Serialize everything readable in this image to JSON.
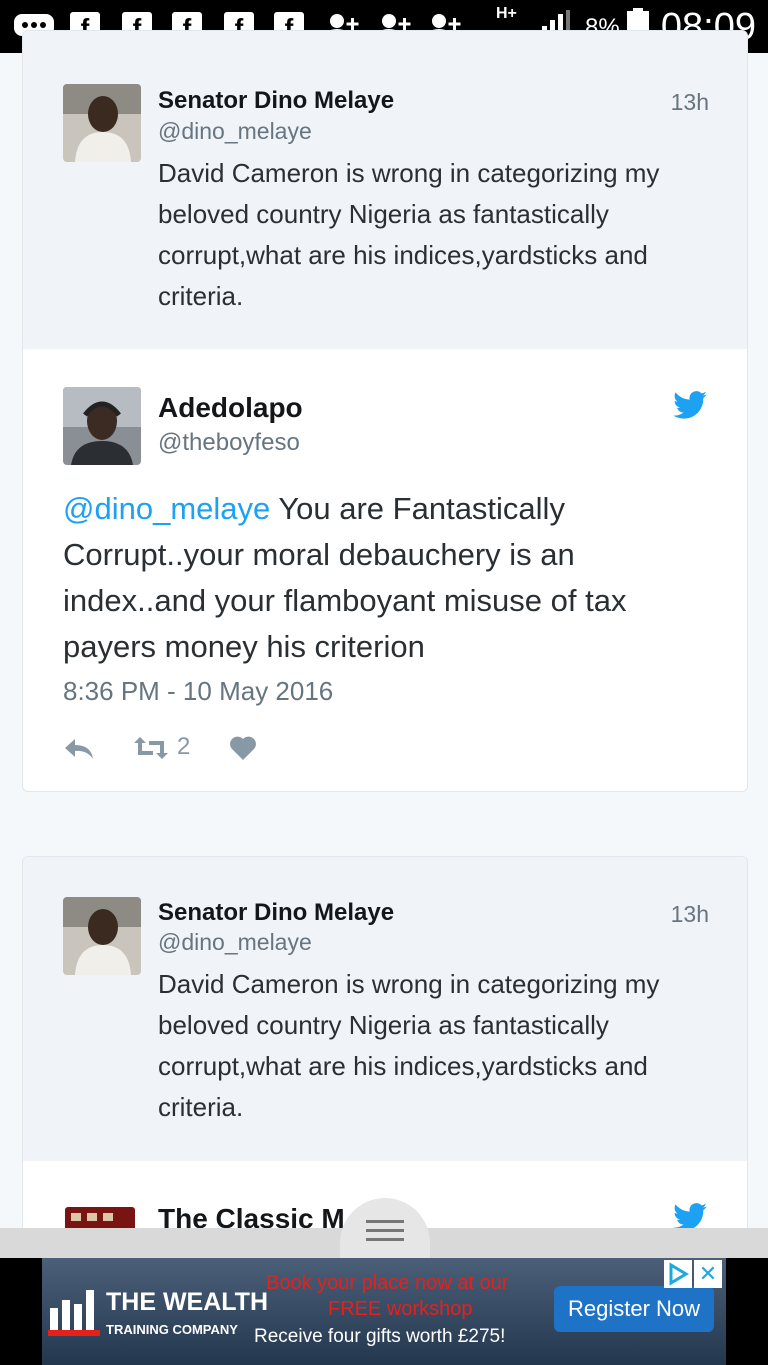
{
  "status_bar": {
    "network": "H+",
    "battery": "8%",
    "time": "08:09",
    "facebook_glyph": "f",
    "icons": [
      "chat-icon",
      "facebook-icon",
      "facebook-icon",
      "facebook-icon",
      "facebook-icon",
      "facebook-icon",
      "add-person-icon",
      "add-person-icon",
      "add-person-icon",
      "signal-icon",
      "battery-icon"
    ]
  },
  "quoted_top": {
    "name": "Senator Dino Melaye",
    "handle": "@dino_melaye",
    "time": "13h",
    "text": "David Cameron is wrong in categorizing my beloved country Nigeria as fantastically corrupt,what are his indices,yardsticks and criteria."
  },
  "tweet": {
    "name": "Adedolapo",
    "handle": "@theboyfeso",
    "mention": "@dino_melaye",
    "text": " You are Fantastically Corrupt..your moral debauchery is an index..and your flamboyant misuse of tax payers money his criterion",
    "timestamp": "8:36 PM - 10 May 2016",
    "retweet_count": "2"
  },
  "second_card": {
    "quoted": {
      "name": "Senator Dino Melaye",
      "handle": "@dino_melaye",
      "time": "13h",
      "text": "David Cameron is wrong in categorizing my beloved country Nigeria as fantastically corrupt,what are his indices,yardsticks and criteria."
    },
    "next_name": "The Classic M"
  },
  "ad": {
    "company_line1": "THE WEALTH",
    "company_line2": "TRAINING COMPANY",
    "headline1": "Book your place now at our",
    "headline2": "FREE workshop",
    "subline": "Receive four gifts worth £275!",
    "cta": "Register Now",
    "close": "✕"
  },
  "colors": {
    "twitter_blue": "#1da1f2",
    "ad_red": "#e8201a",
    "ad_cta": "#1f73c6"
  }
}
